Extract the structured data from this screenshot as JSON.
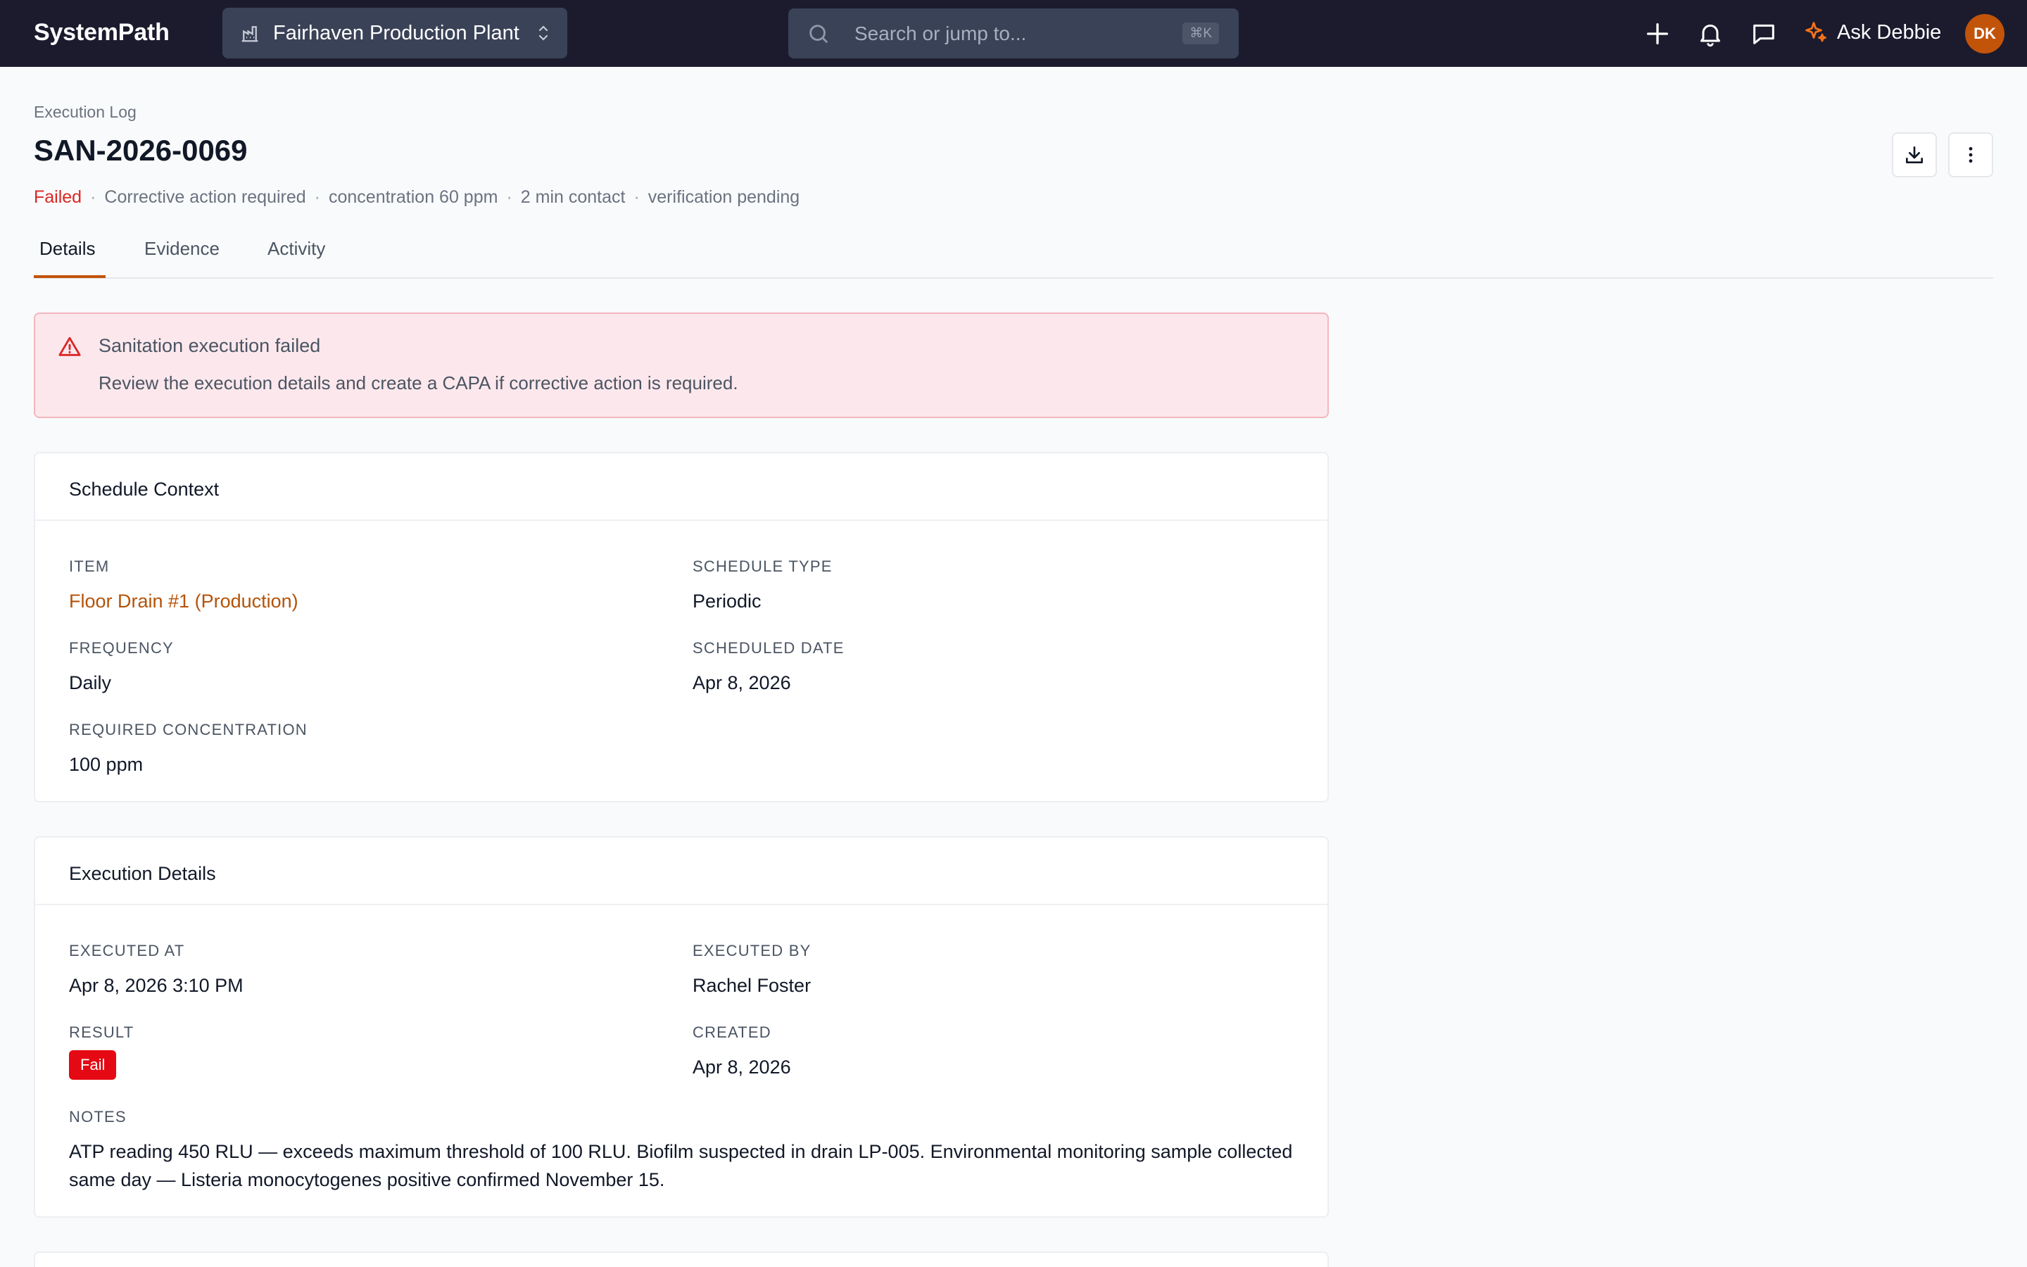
{
  "nav": {
    "logo": "SystemPath",
    "plant": "Fairhaven Production Plant",
    "search_placeholder": "Search or jump to...",
    "shortcut": "⌘K",
    "ask_label": "Ask Debbie",
    "avatar_initials": "DK"
  },
  "header": {
    "eyebrow": "Execution Log",
    "title": "SAN-2026-0069",
    "status": "Failed",
    "meta": [
      "Corrective action required",
      "concentration 60 ppm",
      "2 min contact",
      "verification pending"
    ],
    "separator": "·"
  },
  "tabs": [
    {
      "label": "Details",
      "active": true
    },
    {
      "label": "Evidence",
      "active": false
    },
    {
      "label": "Activity",
      "active": false
    }
  ],
  "alert": {
    "title": "Sanitation execution failed",
    "body": "Review the execution details and create a CAPA if corrective action is required."
  },
  "schedule_context": {
    "heading": "Schedule Context",
    "item_label": "ITEM",
    "item_value": "Floor Drain #1 (Production)",
    "schedule_type_label": "SCHEDULE TYPE",
    "schedule_type_value": "Periodic",
    "frequency_label": "FREQUENCY",
    "frequency_value": "Daily",
    "scheduled_date_label": "SCHEDULED DATE",
    "scheduled_date_value": "Apr 8, 2026",
    "required_concentration_label": "REQUIRED CONCENTRATION",
    "required_concentration_value": "100 ppm"
  },
  "execution_details": {
    "heading": "Execution Details",
    "executed_at_label": "EXECUTED AT",
    "executed_at_value": "Apr 8, 2026 3:10 PM",
    "executed_by_label": "EXECUTED BY",
    "executed_by_value": "Rachel Foster",
    "result_label": "RESULT",
    "result_value": "Fail",
    "created_label": "CREATED",
    "created_value": "Apr 8, 2026",
    "notes_label": "NOTES",
    "notes_value": "ATP reading 450 RLU — exceeds maximum threshold of 100 RLU. Biofilm suspected in drain LP-005. Environmental monitoring sample collected same day — Listeria monocytogenes positive confirmed November 15."
  },
  "colors": {
    "nav_bg": "#1c1b2e",
    "accent": "#c2540a",
    "danger": "#dc2626",
    "alert_bg": "#fce8ec"
  },
  "icons": {
    "plant": "building-icon",
    "plant_toggle": "chevron-up-down-icon",
    "search": "search-icon",
    "add": "plus-icon",
    "notifications": "bell-icon",
    "messages": "chat-icon",
    "ask": "sparkle-icon",
    "download": "download-icon",
    "more": "more-vertical-icon",
    "alert": "warning-triangle-icon"
  }
}
